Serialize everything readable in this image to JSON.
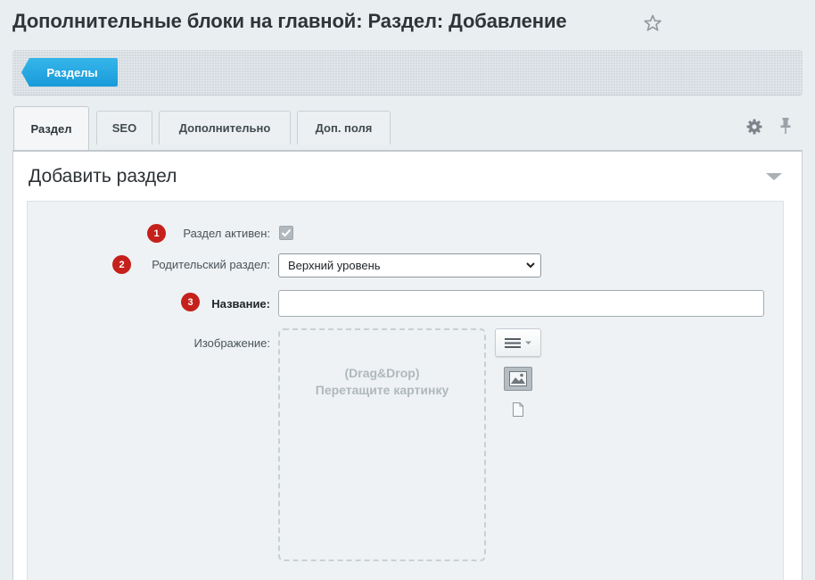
{
  "page": {
    "title": "Дополнительные блоки на главной: Раздел: Добавление"
  },
  "toolbar": {
    "back_label": "Разделы"
  },
  "tabs": [
    {
      "label": "Раздел",
      "active": true
    },
    {
      "label": "SEO",
      "active": false
    },
    {
      "label": "Дополнительно",
      "active": false
    },
    {
      "label": "Доп. поля",
      "active": false
    }
  ],
  "panel": {
    "title": "Добавить раздел"
  },
  "form": {
    "active": {
      "badge": "1",
      "label": "Раздел активен:",
      "checked": true
    },
    "parent": {
      "badge": "2",
      "label": "Родительский раздел:",
      "value": "Верхний уровень"
    },
    "name": {
      "badge": "3",
      "label": "Название:",
      "value": ""
    },
    "image": {
      "label": "Изображение:",
      "drop_line1": "(Drag&Drop)",
      "drop_line2": "Перетащите картинку"
    }
  },
  "colors": {
    "accent": "#1a9ad9",
    "badge": "#c5201b",
    "background": "#e9eef1"
  },
  "icons": [
    "star-icon",
    "gear-icon",
    "pin-icon",
    "collapse-icon",
    "menu-icon",
    "image-icon",
    "file-icon"
  ]
}
